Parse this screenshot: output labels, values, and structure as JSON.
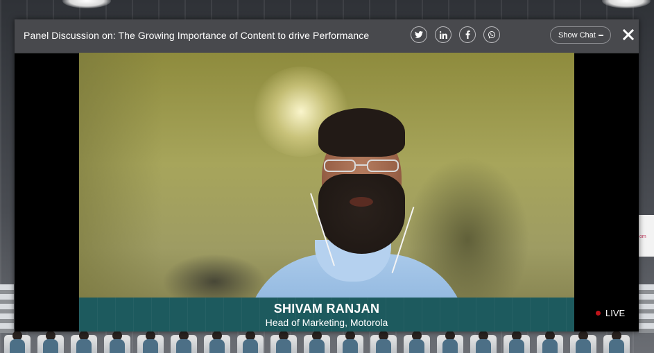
{
  "header": {
    "title": "Panel Discussion on: The Growing Importance of Content to drive Performance",
    "share_icons": [
      "twitter-icon",
      "linkedin-icon",
      "facebook-icon",
      "whatsapp-icon"
    ],
    "show_chat_label": "Show Chat"
  },
  "video": {
    "speaker_name": "SHIVAM RANJAN",
    "speaker_role": "Head of Marketing, Motorola",
    "lower_third_color": "#1d5a5e"
  },
  "status": {
    "live_label": "LIVE",
    "live_color": "#c0141a"
  },
  "background": {
    "sign_text": "om"
  }
}
